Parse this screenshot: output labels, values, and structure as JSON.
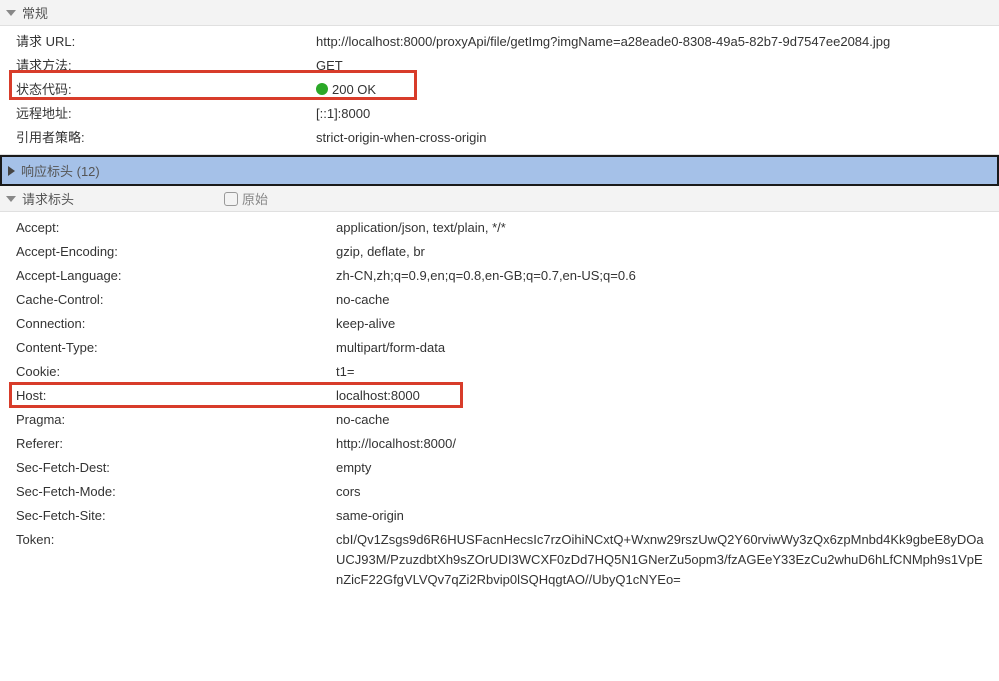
{
  "sections": {
    "general": {
      "title": "常规",
      "items": [
        {
          "label": "请求 URL:",
          "value": "http://localhost:8000/proxyApi/file/getImg?imgName=a28eade0-8308-49a5-82b7-9d7547ee2084.jpg"
        },
        {
          "label": "请求方法:",
          "value": "GET"
        },
        {
          "label": "状态代码:",
          "value": "200 OK",
          "status": true
        },
        {
          "label": "远程地址:",
          "value": "[::1]:8000"
        },
        {
          "label": "引用者策略:",
          "value": "strict-origin-when-cross-origin"
        }
      ]
    },
    "response": {
      "title": "响应标头 (12)"
    },
    "request": {
      "title": "请求标头",
      "raw_label": "原始",
      "items": [
        {
          "label": "Accept:",
          "value": "application/json, text/plain, */*"
        },
        {
          "label": "Accept-Encoding:",
          "value": "gzip, deflate, br"
        },
        {
          "label": "Accept-Language:",
          "value": "zh-CN,zh;q=0.9,en;q=0.8,en-GB;q=0.7,en-US;q=0.6"
        },
        {
          "label": "Cache-Control:",
          "value": "no-cache"
        },
        {
          "label": "Connection:",
          "value": "keep-alive"
        },
        {
          "label": "Content-Type:",
          "value": "multipart/form-data"
        },
        {
          "label": "Cookie:",
          "value": "t1="
        },
        {
          "label": "Host:",
          "value": "localhost:8000"
        },
        {
          "label": "Pragma:",
          "value": "no-cache"
        },
        {
          "label": "Referer:",
          "value": "http://localhost:8000/"
        },
        {
          "label": "Sec-Fetch-Dest:",
          "value": "empty"
        },
        {
          "label": "Sec-Fetch-Mode:",
          "value": "cors"
        },
        {
          "label": "Sec-Fetch-Site:",
          "value": "same-origin"
        },
        {
          "label": "Token:",
          "value": "cbI/Qv1Zsgs9d6R6HUSFacnHecsIc7rzOihiNCxtQ+Wxnw29rszUwQ2Y60rviwWy3zQx6zpMnbd4Kk9gbeE8yDOaUCJ93M/PzuzdbtXh9sZOrUDI3WCXF0zDd7HQ5N1GNerZu5opm3/fzAGEeY33EzCu2whuD6hLfCNMph9s1VpEnZicF22GfgVLVQv7qZi2Rbvip0lSQHqgtAO//UbyQ1cNYEo="
        }
      ]
    }
  }
}
